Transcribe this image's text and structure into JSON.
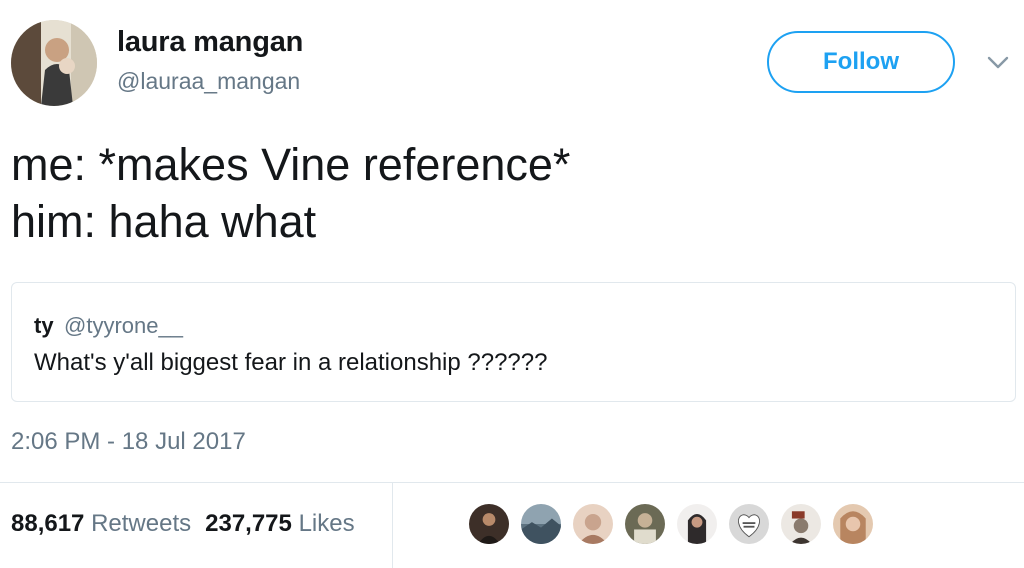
{
  "author": {
    "name": "laura mangan",
    "handle": "@lauraa_mangan"
  },
  "follow_label": "Follow",
  "tweet": {
    "lines": [
      "me: *makes Vine reference*",
      "him: haha what"
    ]
  },
  "quoted": {
    "name": "ty",
    "handle": "@tyyrone__",
    "text": "What's y'all biggest fear in a relationship ??????"
  },
  "timestamp": "2:06 PM - 18 Jul 2017",
  "stats": {
    "retweets_count": "88,617",
    "retweets_label": "Retweets",
    "likes_count": "237,775",
    "likes_label": "Likes"
  },
  "liker_avatars": [
    {
      "icon": "avatar-photo",
      "color": "#3d2f28"
    },
    {
      "icon": "avatar-photo",
      "color": "#8fa3b0"
    },
    {
      "icon": "avatar-photo",
      "color": "#c9a48e"
    },
    {
      "icon": "avatar-photo",
      "color": "#6b6a55"
    },
    {
      "icon": "avatar-photo",
      "color": "#2e2a2b"
    },
    {
      "icon": "avatar-photo",
      "color": "#d8d8d8"
    },
    {
      "icon": "avatar-photo",
      "color": "#8a7b6e"
    },
    {
      "icon": "avatar-photo",
      "color": "#b88560"
    }
  ],
  "colors": {
    "accent": "#1da1f2",
    "secondary_text": "#657786",
    "border": "#e1e8ed"
  }
}
